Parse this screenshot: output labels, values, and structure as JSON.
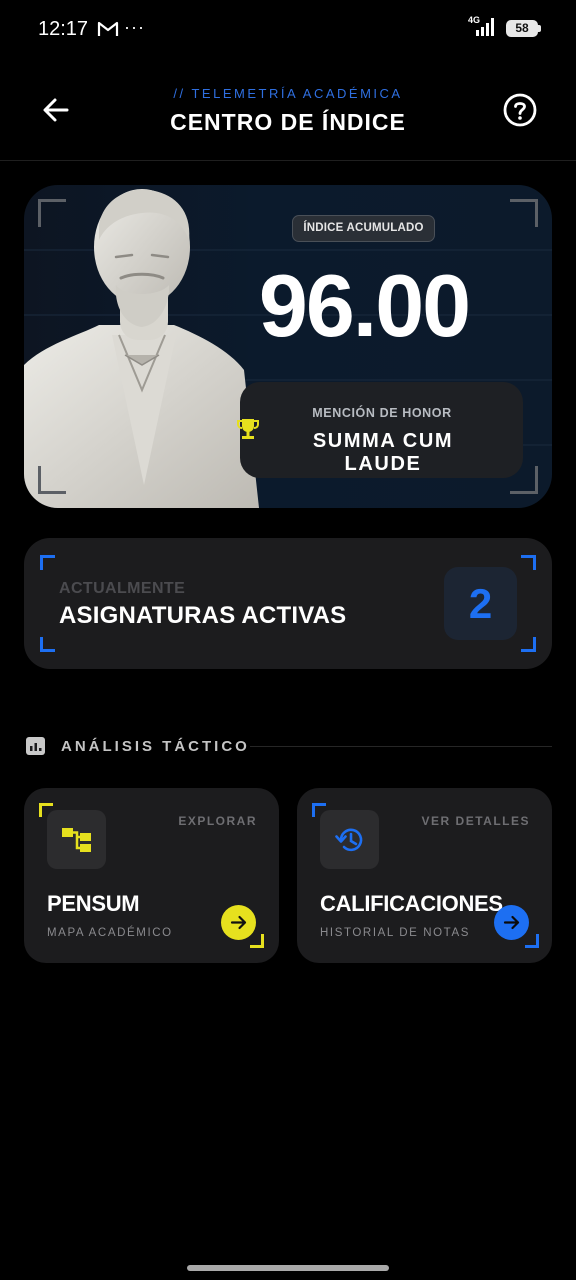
{
  "status_bar": {
    "time": "12:17",
    "more": "···",
    "network": "4G",
    "battery": "58"
  },
  "header": {
    "subtitle": "// TELEMETRÍA ACADÉMICA",
    "title": "CENTRO DE ÍNDICE",
    "back_icon": "arrow-back-icon",
    "help_icon": "help-circle-icon"
  },
  "hero": {
    "badge": "ÍNDICE ACUMULADO",
    "value": "96.00",
    "honor_label": "MENCIÓN DE HONOR",
    "honor_value": "SUMMA CUM LAUDE",
    "honor_icon": "trophy-icon"
  },
  "active_subjects": {
    "label": "ACTUALMENTE",
    "title": "ASIGNATURAS ACTIVAS",
    "count": "2"
  },
  "section": {
    "title": "ANÁLISIS TÁCTICO",
    "icon": "bar-chart-icon"
  },
  "cards": [
    {
      "hint": "EXPLORAR",
      "title": "PENSUM",
      "subtitle": "MAPA ACADÉMICO",
      "icon": "hierarchy-icon",
      "accent": "#e6e01e"
    },
    {
      "hint": "VER DETALLES",
      "title": "CALIFICACIONES",
      "subtitle": "HISTORIAL DE NOTAS",
      "icon": "history-icon",
      "accent": "#1d6ff2"
    }
  ],
  "colors": {
    "background": "#000000",
    "blue_accent": "#1d6ff2",
    "yellow_accent": "#e6e01e",
    "card": "#1c1c1e"
  }
}
